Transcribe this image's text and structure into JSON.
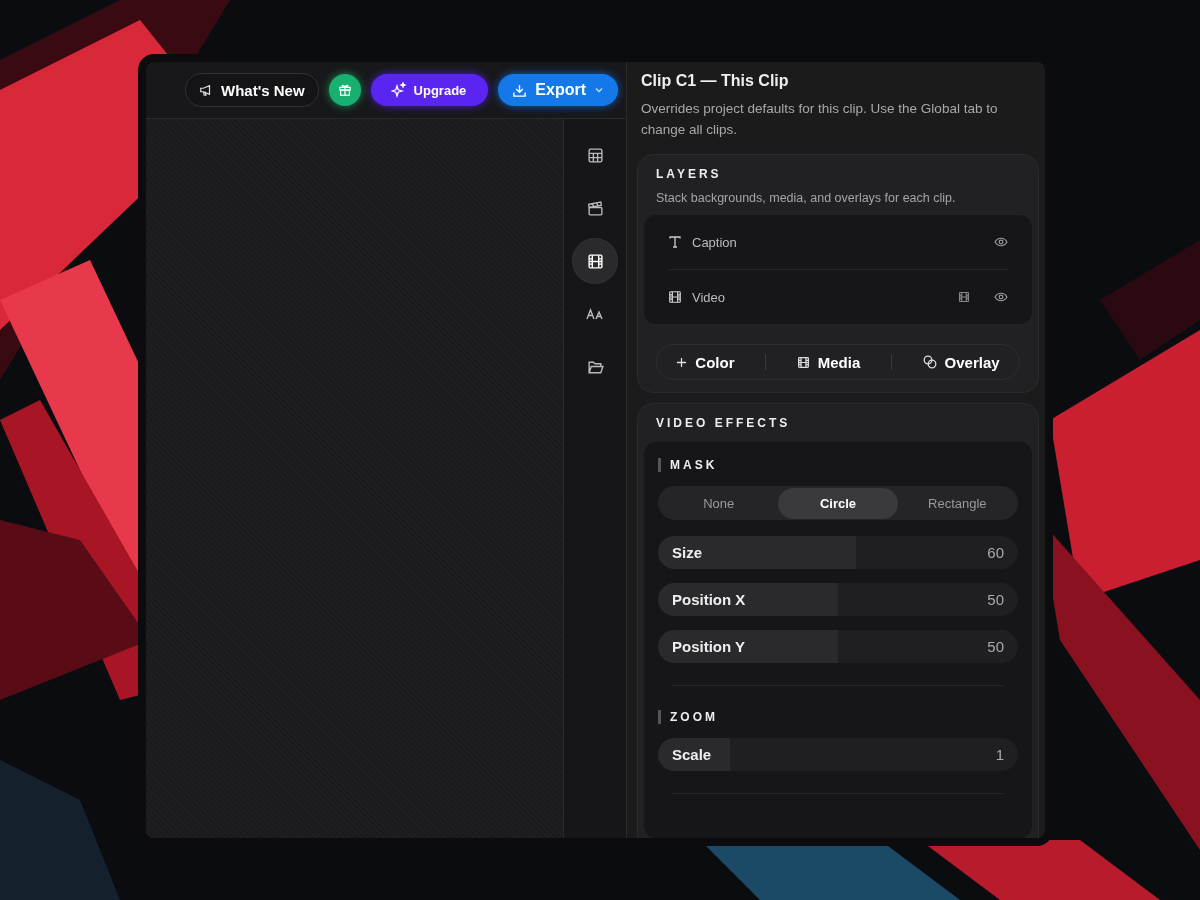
{
  "toolbar": {
    "whats_new": "What's New",
    "upgrade": "Upgrade",
    "export": "Export"
  },
  "rail": [
    {
      "kind": "table",
      "selected": false
    },
    {
      "kind": "clapper",
      "selected": false
    },
    {
      "kind": "film",
      "selected": true
    },
    {
      "kind": "text",
      "selected": false
    },
    {
      "kind": "folder",
      "selected": false
    }
  ],
  "panel": {
    "title": "Clip C1 — This Clip",
    "description": "Overrides project defaults for this clip. Use the Global tab to change all clips.",
    "layers": {
      "heading": "LAYERS",
      "description": "Stack backgrounds, media, and overlays for each clip.",
      "items": [
        {
          "kind": "text",
          "label": "Caption"
        },
        {
          "kind": "video",
          "label": "Video"
        }
      ],
      "add_buttons": [
        {
          "kind": "plus",
          "label": "Color"
        },
        {
          "kind": "film",
          "label": "Media"
        },
        {
          "kind": "overlay",
          "label": "Overlay"
        }
      ]
    },
    "effects": {
      "heading": "VIDEO EFFECTS",
      "sections": [
        {
          "heading": "MASK",
          "options": [
            {
              "label": "None",
              "selected": false
            },
            {
              "label": "Circle",
              "selected": true
            },
            {
              "label": "Rectangle",
              "selected": false
            }
          ],
          "sliders": [
            {
              "label": "Size",
              "value": "60",
              "level": 0.55
            },
            {
              "label": "Position X",
              "value": "50",
              "level": 0.5
            },
            {
              "label": "Position Y",
              "value": "50",
              "level": 0.5
            }
          ]
        },
        {
          "heading": "ZOOM",
          "sliders": [
            {
              "label": "Scale",
              "value": "1",
              "level": 0.2
            }
          ]
        }
      ]
    }
  }
}
